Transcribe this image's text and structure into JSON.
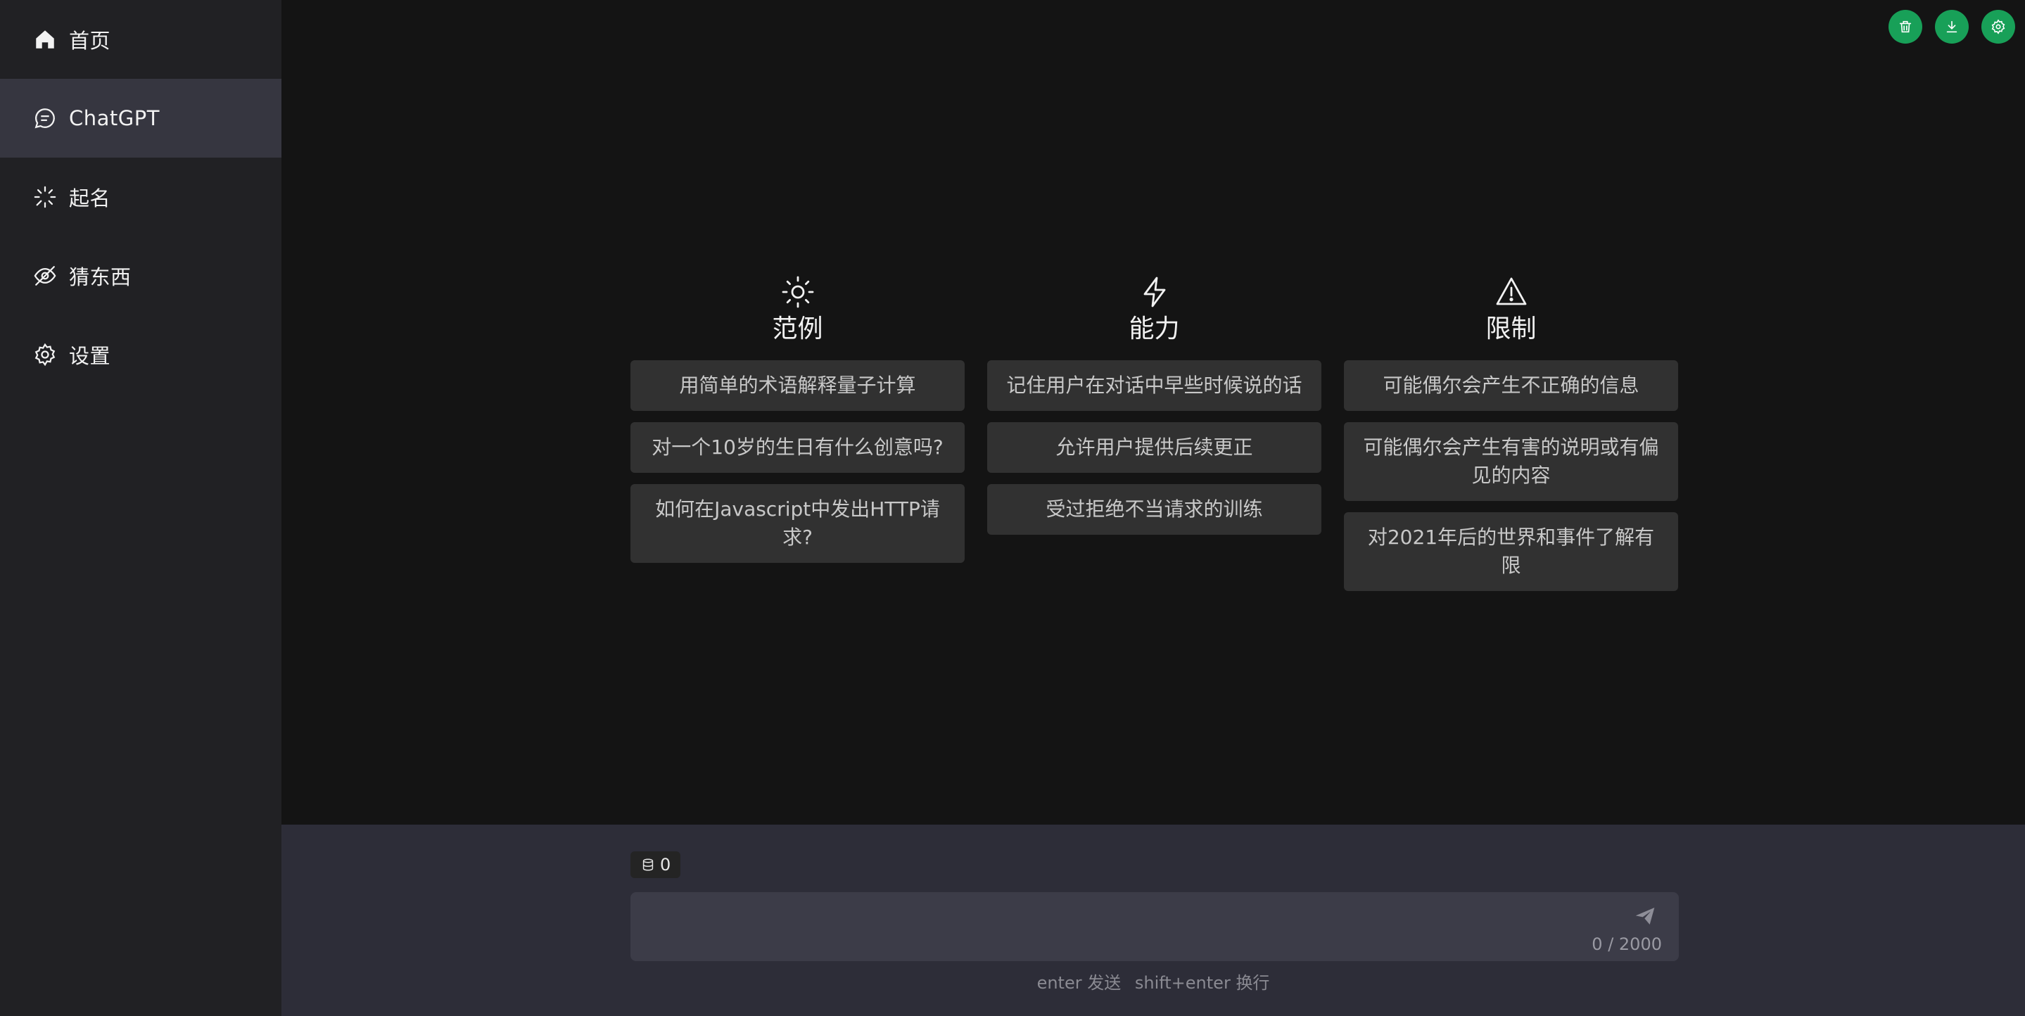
{
  "sidebar": {
    "items": [
      {
        "label": "首页",
        "icon": "home-icon",
        "active": false
      },
      {
        "label": "ChatGPT",
        "icon": "chat-icon",
        "active": true
      },
      {
        "label": "起名",
        "icon": "sparkle-icon",
        "active": false
      },
      {
        "label": "猜东西",
        "icon": "eye-off-icon",
        "active": false
      },
      {
        "label": "设置",
        "icon": "gear-icon",
        "active": false
      }
    ]
  },
  "top_actions": [
    "trash-icon",
    "download-icon",
    "settings-icon"
  ],
  "columns": [
    {
      "title": "范例",
      "icon": "sun-icon",
      "cards": [
        "用简单的术语解释量子计算",
        "对一个10岁的生日有什么创意吗?",
        "如何在Javascript中发出HTTP请求?"
      ]
    },
    {
      "title": "能力",
      "icon": "lightning-icon",
      "cards": [
        "记住用户在对话中早些时候说的话",
        "允许用户提供后续更正",
        "受过拒绝不当请求的训练"
      ]
    },
    {
      "title": "限制",
      "icon": "warning-icon",
      "cards": [
        "可能偶尔会产生不正确的信息",
        "可能偶尔会产生有害的说明或有偏见的内容",
        "对2021年后的世界和事件了解有限"
      ]
    }
  ],
  "input": {
    "token_count": "0",
    "value": "",
    "counter": "0 / 2000",
    "hint_send": "enter 发送",
    "hint_newline": "shift+enter 换行"
  },
  "colors": {
    "accent": "#18a058",
    "sidebar_bg": "#212124",
    "main_bg": "#141414",
    "card_bg": "#313131",
    "input_area_bg": "#2d2d38"
  }
}
